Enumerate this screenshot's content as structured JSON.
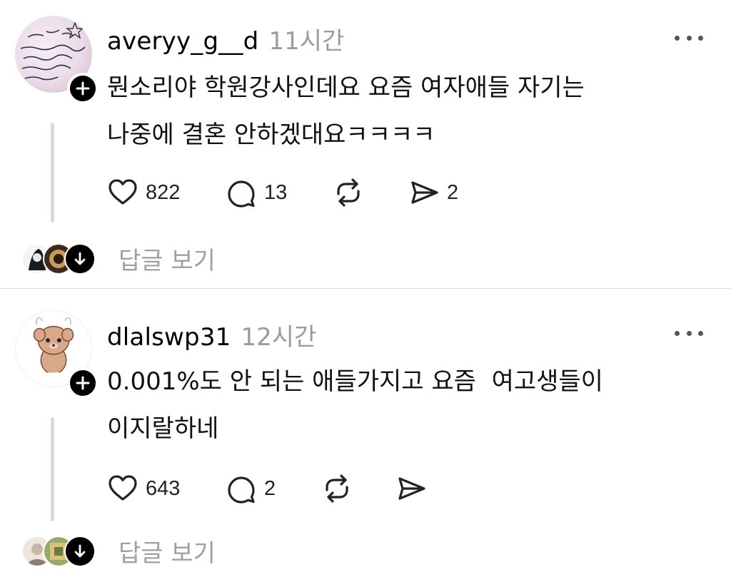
{
  "posts": [
    {
      "username": "averyy_g__d",
      "time": "11시간",
      "text_lines": [
        "뭔소리야 학원강사인데요 요즘 여자애들 자기는",
        "나중에 결혼 안하겠대요ㅋㅋㅋㅋ"
      ],
      "likes": "822",
      "comments": "13",
      "shares": "2",
      "view_replies": "답글 보기",
      "avatar_icon": "handwritten-note-avatar",
      "follow_icon": "plus-icon"
    },
    {
      "username": "dlalswp31",
      "time": "12시간",
      "text_lines": [
        "0.001%도 안 되는 애들가지고 요즘  여고생들이",
        "이지랄하네"
      ],
      "likes": "643",
      "comments": "2",
      "shares": "",
      "view_replies": "답글 보기",
      "avatar_icon": "bear-character-avatar",
      "follow_icon": "plus-icon"
    }
  ],
  "icons": {
    "like": "heart-icon",
    "comment": "speech-bubble-icon",
    "repost": "repost-icon",
    "share": "paper-plane-icon",
    "more": "more-dots-icon",
    "expand": "arrow-down-icon"
  },
  "colors": {
    "text": "#000000",
    "muted": "#9b9b9b",
    "thread_line": "#d9d9d9",
    "badge": "#000000"
  }
}
